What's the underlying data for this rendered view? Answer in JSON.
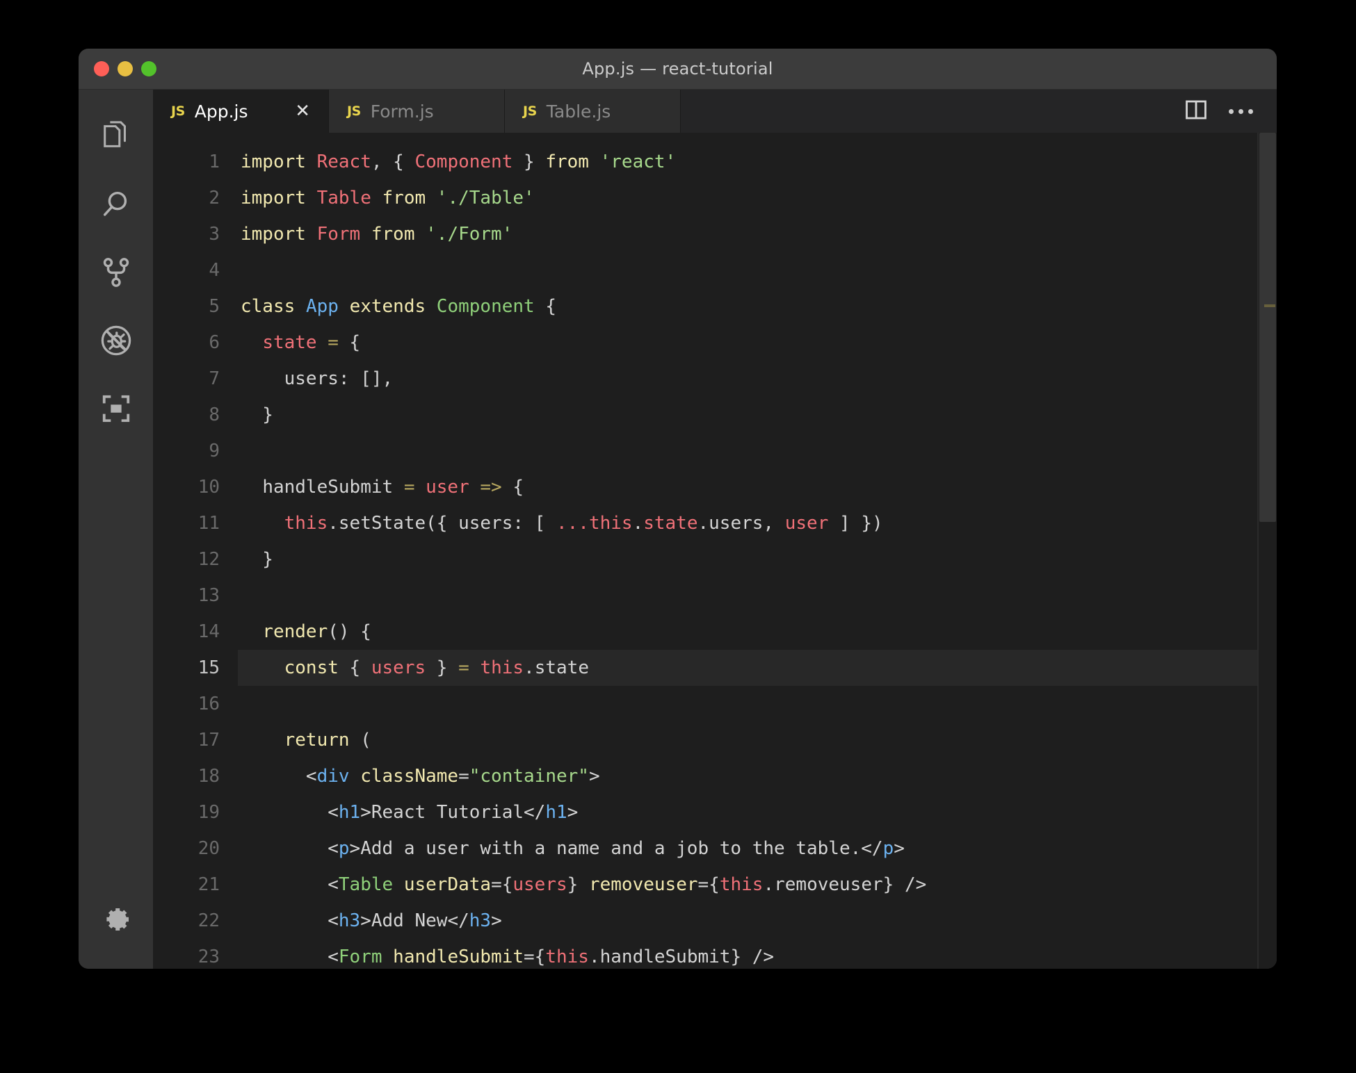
{
  "window": {
    "title": "App.js — react-tutorial",
    "traffic_lights": [
      {
        "name": "close",
        "color": "#ff5f57"
      },
      {
        "name": "minimize",
        "color": "#e8bf42"
      },
      {
        "name": "zoom",
        "color": "#53c22b"
      }
    ]
  },
  "activitybar": {
    "items": [
      {
        "icon": "files-explorer-icon",
        "label": "Explorer"
      },
      {
        "icon": "search-icon",
        "label": "Search"
      },
      {
        "icon": "source-control-icon",
        "label": "Source Control"
      },
      {
        "icon": "run-and-debug-icon",
        "label": "Run and Debug"
      },
      {
        "icon": "extensions-icon",
        "label": "Extensions"
      }
    ],
    "bottom": [
      {
        "icon": "gear-icon",
        "label": "Manage"
      }
    ]
  },
  "tabs": [
    {
      "badge": "JS",
      "label": "App.js",
      "active": true,
      "close": "✕"
    },
    {
      "badge": "JS",
      "label": "Form.js",
      "active": false,
      "close": ""
    },
    {
      "badge": "JS",
      "label": "Table.js",
      "active": false,
      "close": ""
    }
  ],
  "editor_actions": [
    {
      "icon": "split-editor-icon",
      "label": "Split Editor"
    },
    {
      "icon": "more-actions-icon",
      "label": "More Actions..."
    }
  ],
  "editor": {
    "filename": "App.js",
    "language": "javascript",
    "current_line": 15,
    "line_numbers": [
      1,
      2,
      3,
      4,
      5,
      6,
      7,
      8,
      9,
      10,
      11,
      12,
      13,
      14,
      15,
      16,
      17,
      18,
      19,
      20,
      21,
      22,
      23
    ],
    "code_lines": [
      {
        "n": 1,
        "tokens": [
          {
            "t": "import",
            "c": "t-kw"
          },
          {
            "t": " ",
            "c": "t-plain"
          },
          {
            "t": "React",
            "c": "t-ident"
          },
          {
            "t": ", ",
            "c": "t-punc"
          },
          {
            "t": "{ ",
            "c": "t-punc"
          },
          {
            "t": "Component",
            "c": "t-ident"
          },
          {
            "t": " } ",
            "c": "t-punc"
          },
          {
            "t": "from",
            "c": "t-kw"
          },
          {
            "t": " ",
            "c": "t-plain"
          },
          {
            "t": "'react'",
            "c": "t-str"
          }
        ]
      },
      {
        "n": 2,
        "tokens": [
          {
            "t": "import",
            "c": "t-kw"
          },
          {
            "t": " ",
            "c": "t-plain"
          },
          {
            "t": "Table",
            "c": "t-ident"
          },
          {
            "t": " ",
            "c": "t-plain"
          },
          {
            "t": "from",
            "c": "t-kw"
          },
          {
            "t": " ",
            "c": "t-plain"
          },
          {
            "t": "'./Table'",
            "c": "t-str"
          }
        ]
      },
      {
        "n": 3,
        "tokens": [
          {
            "t": "import",
            "c": "t-kw"
          },
          {
            "t": " ",
            "c": "t-plain"
          },
          {
            "t": "Form",
            "c": "t-ident"
          },
          {
            "t": " ",
            "c": "t-plain"
          },
          {
            "t": "from",
            "c": "t-kw"
          },
          {
            "t": " ",
            "c": "t-plain"
          },
          {
            "t": "'./Form'",
            "c": "t-str"
          }
        ]
      },
      {
        "n": 4,
        "tokens": []
      },
      {
        "n": 5,
        "tokens": [
          {
            "t": "class",
            "c": "t-kw"
          },
          {
            "t": " ",
            "c": "t-plain"
          },
          {
            "t": "App",
            "c": "t-cls"
          },
          {
            "t": " ",
            "c": "t-plain"
          },
          {
            "t": "extends",
            "c": "t-kw"
          },
          {
            "t": " ",
            "c": "t-plain"
          },
          {
            "t": "Component",
            "c": "t-type"
          },
          {
            "t": " {",
            "c": "t-punc"
          }
        ]
      },
      {
        "n": 6,
        "tokens": [
          {
            "t": "  ",
            "c": "t-plain"
          },
          {
            "t": "state",
            "c": "t-ident"
          },
          {
            "t": " ",
            "c": "t-plain"
          },
          {
            "t": "=",
            "c": "t-op"
          },
          {
            "t": " {",
            "c": "t-punc"
          }
        ]
      },
      {
        "n": 7,
        "tokens": [
          {
            "t": "    users",
            "c": "t-plain"
          },
          {
            "t": ":",
            "c": "t-punc"
          },
          {
            "t": " [],",
            "c": "t-plain"
          }
        ]
      },
      {
        "n": 8,
        "tokens": [
          {
            "t": "  }",
            "c": "t-punc"
          }
        ]
      },
      {
        "n": 9,
        "tokens": []
      },
      {
        "n": 10,
        "tokens": [
          {
            "t": "  ",
            "c": "t-plain"
          },
          {
            "t": "handleSubmit",
            "c": "t-plain"
          },
          {
            "t": " ",
            "c": "t-plain"
          },
          {
            "t": "=",
            "c": "t-op"
          },
          {
            "t": " ",
            "c": "t-plain"
          },
          {
            "t": "user",
            "c": "t-ident"
          },
          {
            "t": " ",
            "c": "t-plain"
          },
          {
            "t": "=>",
            "c": "t-op"
          },
          {
            "t": " {",
            "c": "t-punc"
          }
        ]
      },
      {
        "n": 11,
        "tokens": [
          {
            "t": "    ",
            "c": "t-plain"
          },
          {
            "t": "this",
            "c": "t-ident"
          },
          {
            "t": ".setState({ users",
            "c": "t-plain"
          },
          {
            "t": ":",
            "c": "t-punc"
          },
          {
            "t": " [ ",
            "c": "t-plain"
          },
          {
            "t": "...this",
            "c": "t-ident"
          },
          {
            "t": ".",
            "c": "t-plain"
          },
          {
            "t": "state",
            "c": "t-ident"
          },
          {
            "t": ".users, ",
            "c": "t-plain"
          },
          {
            "t": "user",
            "c": "t-ident"
          },
          {
            "t": " ] })",
            "c": "t-plain"
          }
        ]
      },
      {
        "n": 12,
        "tokens": [
          {
            "t": "  }",
            "c": "t-punc"
          }
        ]
      },
      {
        "n": 13,
        "tokens": []
      },
      {
        "n": 14,
        "tokens": [
          {
            "t": "  ",
            "c": "t-plain"
          },
          {
            "t": "render",
            "c": "t-kw"
          },
          {
            "t": "() {",
            "c": "t-punc"
          }
        ]
      },
      {
        "n": 15,
        "tokens": [
          {
            "t": "    ",
            "c": "t-plain"
          },
          {
            "t": "const",
            "c": "t-kw"
          },
          {
            "t": " { ",
            "c": "t-punc"
          },
          {
            "t": "users",
            "c": "t-ident"
          },
          {
            "t": " } ",
            "c": "t-punc"
          },
          {
            "t": "=",
            "c": "t-op"
          },
          {
            "t": " ",
            "c": "t-plain"
          },
          {
            "t": "this",
            "c": "t-ident"
          },
          {
            "t": ".state",
            "c": "t-plain"
          }
        ],
        "highlight": true
      },
      {
        "n": 16,
        "tokens": []
      },
      {
        "n": 17,
        "tokens": [
          {
            "t": "    ",
            "c": "t-plain"
          },
          {
            "t": "return",
            "c": "t-kw"
          },
          {
            "t": " (",
            "c": "t-punc"
          }
        ]
      },
      {
        "n": 18,
        "tokens": [
          {
            "t": "      <",
            "c": "t-tagp"
          },
          {
            "t": "div",
            "c": "t-tag"
          },
          {
            "t": " ",
            "c": "t-plain"
          },
          {
            "t": "className",
            "c": "t-attr"
          },
          {
            "t": "=",
            "c": "t-plain"
          },
          {
            "t": "\"container\"",
            "c": "t-str"
          },
          {
            "t": ">",
            "c": "t-tagp"
          }
        ]
      },
      {
        "n": 19,
        "tokens": [
          {
            "t": "        <",
            "c": "t-tagp"
          },
          {
            "t": "h1",
            "c": "t-tag"
          },
          {
            "t": ">",
            "c": "t-tagp"
          },
          {
            "t": "React Tutorial",
            "c": "t-plain"
          },
          {
            "t": "</",
            "c": "t-tagp"
          },
          {
            "t": "h1",
            "c": "t-tag"
          },
          {
            "t": ">",
            "c": "t-tagp"
          }
        ]
      },
      {
        "n": 20,
        "tokens": [
          {
            "t": "        <",
            "c": "t-tagp"
          },
          {
            "t": "p",
            "c": "t-tag"
          },
          {
            "t": ">",
            "c": "t-tagp"
          },
          {
            "t": "Add a user with a name and a job to the table.",
            "c": "t-plain"
          },
          {
            "t": "</",
            "c": "t-tagp"
          },
          {
            "t": "p",
            "c": "t-tag"
          },
          {
            "t": ">",
            "c": "t-tagp"
          }
        ]
      },
      {
        "n": 21,
        "tokens": [
          {
            "t": "        <",
            "c": "t-tagp"
          },
          {
            "t": "Table",
            "c": "t-comp"
          },
          {
            "t": " ",
            "c": "t-plain"
          },
          {
            "t": "userData",
            "c": "t-attr"
          },
          {
            "t": "={",
            "c": "t-plain"
          },
          {
            "t": "users",
            "c": "t-ident"
          },
          {
            "t": "} ",
            "c": "t-plain"
          },
          {
            "t": "removeuser",
            "c": "t-attr"
          },
          {
            "t": "={",
            "c": "t-plain"
          },
          {
            "t": "this",
            "c": "t-ident"
          },
          {
            "t": ".removeuser} ",
            "c": "t-plain"
          },
          {
            "t": "/>",
            "c": "t-tagp"
          }
        ]
      },
      {
        "n": 22,
        "tokens": [
          {
            "t": "        <",
            "c": "t-tagp"
          },
          {
            "t": "h3",
            "c": "t-tag"
          },
          {
            "t": ">",
            "c": "t-tagp"
          },
          {
            "t": "Add New",
            "c": "t-plain"
          },
          {
            "t": "</",
            "c": "t-tagp"
          },
          {
            "t": "h3",
            "c": "t-tag"
          },
          {
            "t": ">",
            "c": "t-tagp"
          }
        ]
      },
      {
        "n": 23,
        "tokens": [
          {
            "t": "        <",
            "c": "t-tagp"
          },
          {
            "t": "Form",
            "c": "t-comp"
          },
          {
            "t": " ",
            "c": "t-plain"
          },
          {
            "t": "handleSubmit",
            "c": "t-attr"
          },
          {
            "t": "={",
            "c": "t-plain"
          },
          {
            "t": "this",
            "c": "t-ident"
          },
          {
            "t": ".handleSubmit} ",
            "c": "t-plain"
          },
          {
            "t": "/>",
            "c": "t-tagp"
          }
        ]
      }
    ],
    "overview_marks": [
      {
        "top_pct": 20.5,
        "color": "#8a7a2a"
      }
    ]
  },
  "theme": {
    "background": "#1e1e1e",
    "titlebar": "#3c3c3c",
    "activitybar": "#333333",
    "tabbar": "#252526",
    "tab_inactive": "#2d2d2d",
    "accent_js": "#e8d44d",
    "line_highlight": "#282828",
    "foreground": "#d4d4d4"
  }
}
